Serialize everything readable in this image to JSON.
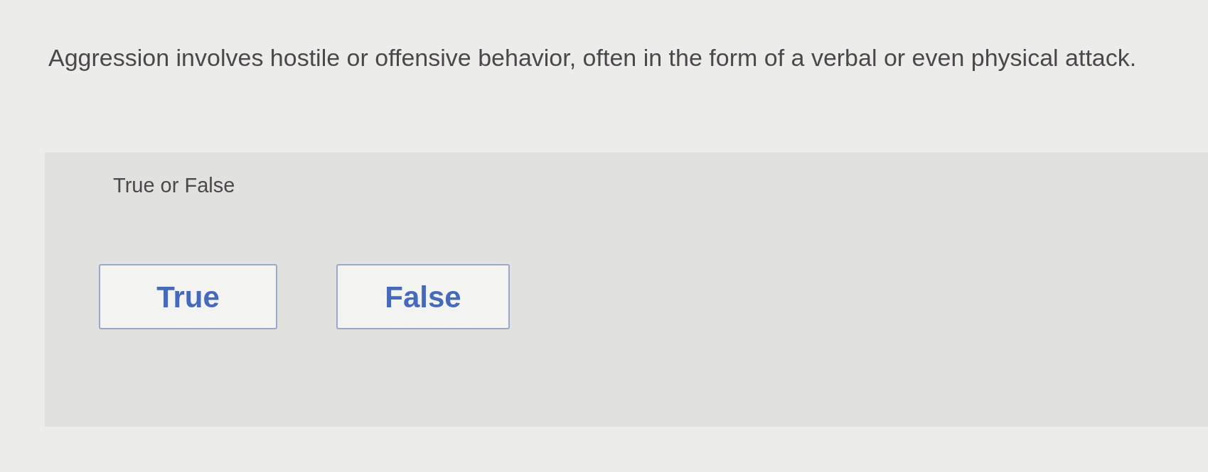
{
  "question": {
    "text": "Aggression involves hostile or offensive behavior, often in the form of a verbal or even physical attack."
  },
  "answer_panel": {
    "prompt": "True or False",
    "options": [
      {
        "label": "True",
        "selected": false
      },
      {
        "label": "False",
        "selected": false
      }
    ]
  }
}
